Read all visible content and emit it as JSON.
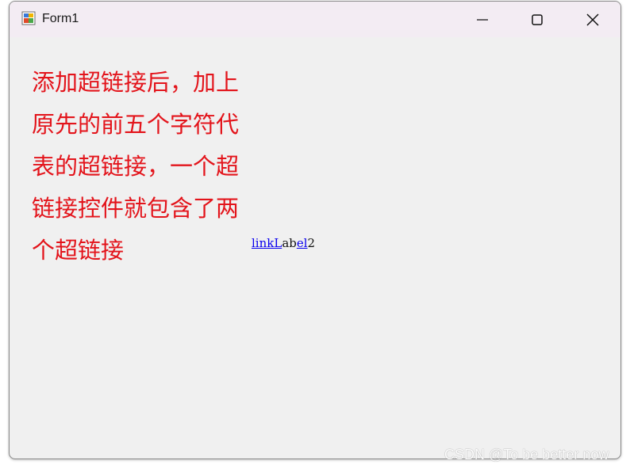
{
  "window": {
    "title": "Form1",
    "controls": {
      "minimize_icon": "minimize-icon",
      "maximize_icon": "maximize-icon",
      "close_icon": "close-icon"
    }
  },
  "content": {
    "lines": [
      "添加超链接后，加上",
      "原先的前五个字符代",
      "表的超链接，一个超",
      "链接控件就包含了两",
      "个超链接"
    ],
    "text_color": "#e3141b"
  },
  "link_label": {
    "link1": "linkL",
    "plain1": "ab",
    "link2": "el",
    "plain2": "2",
    "link_color": "#0a00ee"
  },
  "watermark": "CSDN @To be better now"
}
